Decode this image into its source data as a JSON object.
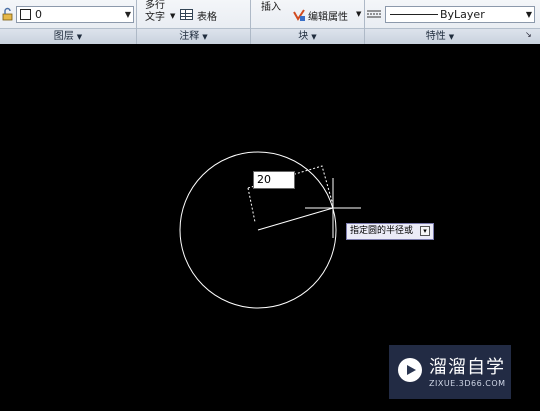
{
  "ribbon": {
    "layer": {
      "current_layer": "0"
    },
    "annotation": {
      "mtext_label_1": "多行",
      "mtext_label_2": "文字",
      "table_label": "表格"
    },
    "block": {
      "insert_label": "插入",
      "edit_attribute_label": "编辑属性"
    },
    "properties": {
      "linetype": "ByLayer"
    },
    "panel_titles": {
      "layers": "图层",
      "annotation": "注释",
      "block": "块",
      "properties": "特性"
    }
  },
  "drawing": {
    "dynamic_input_value": "20",
    "prompt_tooltip": "指定圆的半径或",
    "colors": {
      "background": "#000000",
      "geometry": "#ffffff"
    }
  },
  "watermark": {
    "brand_cn": "溜溜自学",
    "brand_url": "ZIXUE.3D66.COM"
  },
  "icons": [
    "layer-lock-icon",
    "dropdown-arrow-icon",
    "table-icon",
    "edit-attribute-icon",
    "linetype-icon",
    "panel-launcher-icon",
    "tooltip-options-icon",
    "watermark-play-icon"
  ]
}
